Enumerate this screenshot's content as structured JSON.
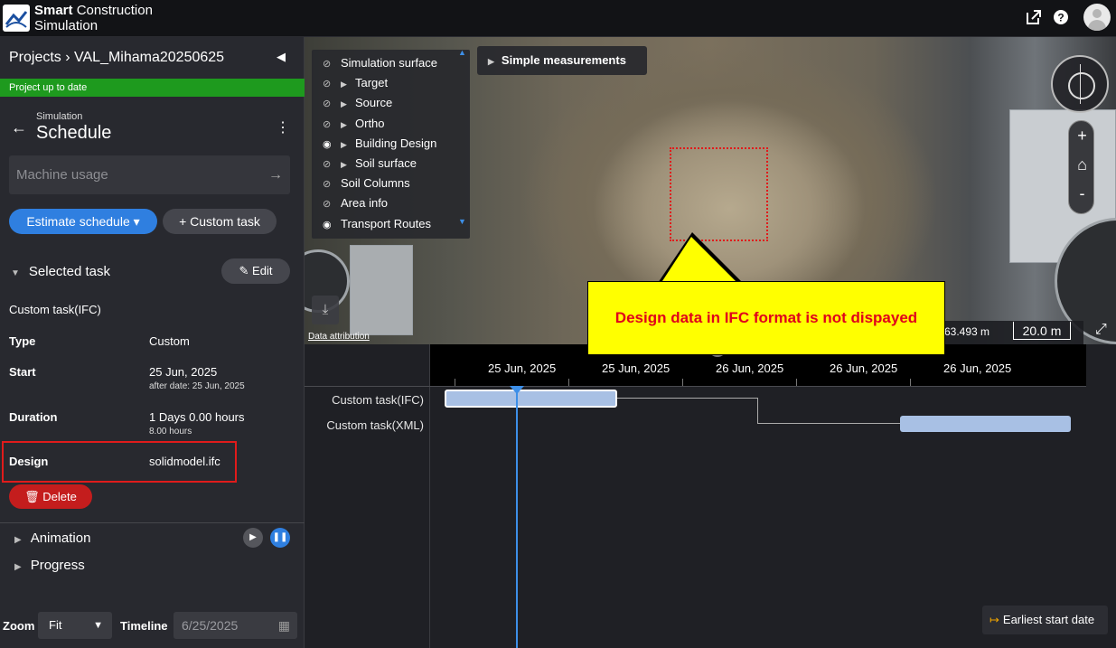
{
  "app": {
    "brand_line1_bold": "Smart",
    "brand_line1": " Construction",
    "brand_line2": "Simulation"
  },
  "topbar": {
    "external_icon": "external-link-icon",
    "help_icon": "help-icon",
    "avatar_icon": "user-avatar"
  },
  "left": {
    "breadcrumb": "Projects › VAL_Mihama20250625",
    "status": "Project up to date",
    "section_label": "Simulation",
    "title": "Schedule",
    "machine_placeholder": "Machine usage",
    "estimate_label": "Estimate schedule ▾",
    "custom_task_label": "+ Custom task",
    "selected_task": "Selected task",
    "edit_label": "Edit",
    "task_name": "Custom task(IFC)",
    "type_label": "Type",
    "type_value": "Custom",
    "start_label": "Start",
    "start_value": "25 Jun, 2025",
    "start_sub": "after date: 25 Jun, 2025",
    "duration_label": "Duration",
    "duration_value": "1 Days 0.00 hours",
    "duration_sub": "8.00 hours",
    "design_label": "Design",
    "design_value": "solidmodel.ifc",
    "delete_label": "Delete",
    "animation": "Animation",
    "progress": "Progress",
    "zoom_label": "Zoom",
    "zoom_value": "Fit",
    "timeline_label": "Timeline",
    "timeline_value": "6/25/2025"
  },
  "map": {
    "layers": [
      {
        "label": "Simulation surface",
        "eye": "hidden",
        "expand": false
      },
      {
        "label": "Target",
        "eye": "hidden",
        "expand": true
      },
      {
        "label": "Source",
        "eye": "hidden",
        "expand": true
      },
      {
        "label": "Ortho",
        "eye": "hidden",
        "expand": true
      },
      {
        "label": "Building Design",
        "eye": "visible",
        "expand": true
      },
      {
        "label": "Soil surface",
        "eye": "hidden",
        "expand": true
      },
      {
        "label": "Soil Columns",
        "eye": "hidden",
        "expand": false
      },
      {
        "label": "Area info",
        "eye": "hidden",
        "expand": false
      },
      {
        "label": "Transport Routes",
        "eye": "visible",
        "expand": false
      }
    ],
    "simple_measurements": "Simple measurements",
    "zoom_in": "+",
    "zoom_out": "-",
    "attribution": "Data attribution",
    "distance": "63.493 m",
    "scale": "20.0 m",
    "callout": "Design data in IFC format is not dispayed"
  },
  "timeline": {
    "dates": [
      "25 Jun, 2025",
      "25 Jun, 2025",
      "26 Jun, 2025",
      "26 Jun, 2025",
      "26 Jun, 2025"
    ],
    "rows": [
      "Custom task(IFC)",
      "Custom task(XML)"
    ],
    "earliest_label": "Earliest start date"
  }
}
